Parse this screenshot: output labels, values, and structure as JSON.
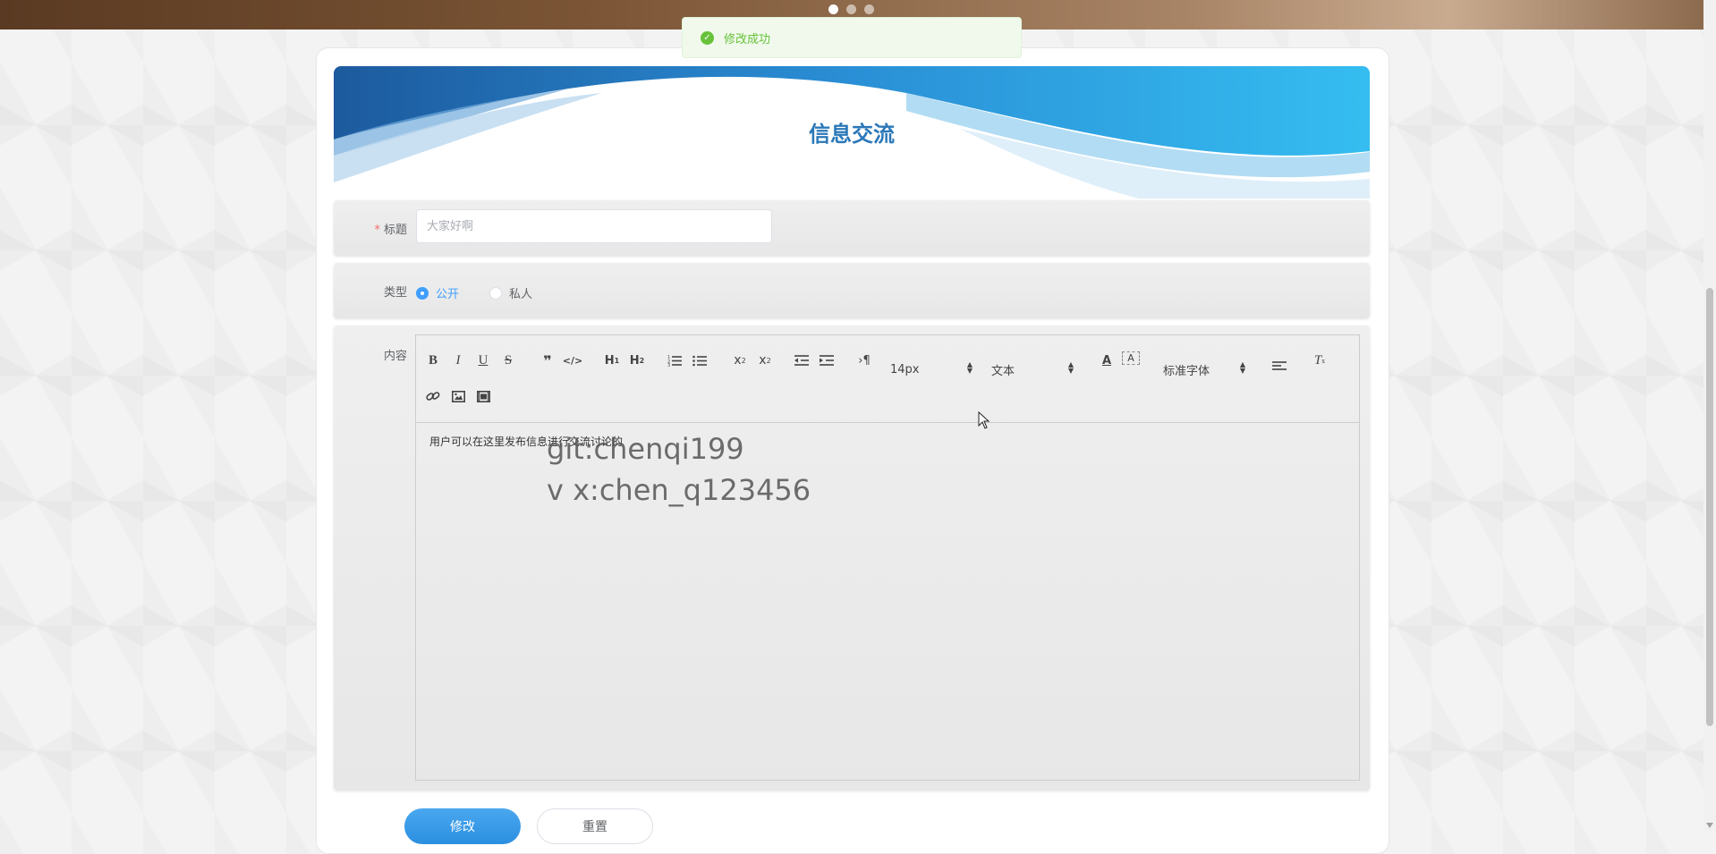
{
  "carousel": {
    "dots": 3,
    "active": 0
  },
  "toast": {
    "icon": "check-circle-icon",
    "message": "修改成功",
    "color": "#67c23a"
  },
  "header": {
    "title": "信息交流"
  },
  "form": {
    "title_field": {
      "label": "标题",
      "required_mark": "*",
      "placeholder": "大家好啊",
      "value": ""
    },
    "type_field": {
      "label": "类型",
      "options": [
        {
          "label": "公开",
          "checked": true
        },
        {
          "label": "私人",
          "checked": false
        }
      ]
    },
    "content_field": {
      "label": "内容",
      "editor": {
        "font_size": "14px",
        "header_picker": "文本",
        "font_family": "标准字体",
        "body": "用户可以在这里发布信息进行交流讨论的"
      }
    }
  },
  "watermark": {
    "line1": "git:chenqi199",
    "line2": "v x:chen_q123456"
  },
  "buttons": {
    "submit": "修改",
    "reset": "重置"
  },
  "colors": {
    "primary": "#409eff",
    "title": "#2b78b8",
    "success": "#67c23a"
  }
}
